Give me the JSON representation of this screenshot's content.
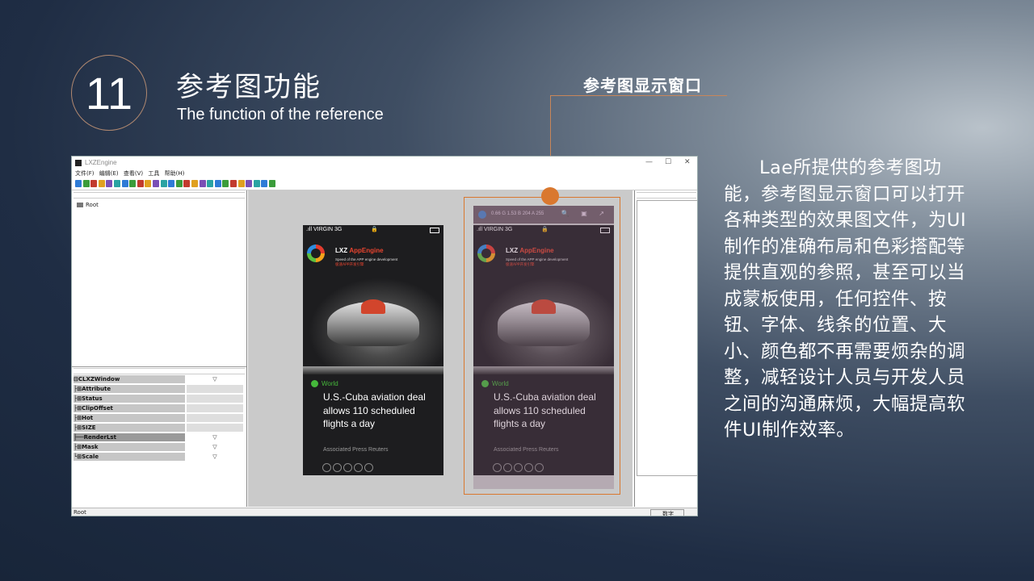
{
  "slide": {
    "number": "11",
    "title_cn": "参考图功能",
    "title_en": "The function of the reference",
    "callout_label": "参考图显示窗口",
    "description": "Lae所提供的参考图功能，参考图显示窗口可以打开各种类型的效果图文件，为UI制作的准确布局和色彩搭配等提供直观的参照，甚至可以当成蒙板使用，任何控件、按钮、字体、线条的位置、大小、颜色都不再需要烦杂的调整，减轻设计人员与开发人员之间的沟通麻烦，大幅提高软件UI制作效率。"
  },
  "app": {
    "window_title": "LXZEngine",
    "window_controls": [
      "—",
      "☐",
      "✕"
    ],
    "menu": [
      "文件(F)",
      "编辑(E)",
      "查看(V)",
      "工具",
      "帮助(H)"
    ],
    "tree_root": "Root",
    "properties": [
      {
        "name": "⊟CLXZWindow",
        "value": "▽",
        "dark": false
      },
      {
        "name": "├⊞Attribute",
        "value": "",
        "dark": false
      },
      {
        "name": "├⊞Status",
        "value": "",
        "dark": false
      },
      {
        "name": "├⊞ClipOffset",
        "value": "",
        "dark": false
      },
      {
        "name": "├⊞Hot",
        "value": "",
        "dark": false
      },
      {
        "name": "├⊞SIZE",
        "value": "",
        "dark": false
      },
      {
        "name": "├──RenderLst",
        "value": "▽",
        "dark": true
      },
      {
        "name": "├⊞Mask",
        "value": "▽",
        "dark": false
      },
      {
        "name": "└⊞Scale",
        "value": "▽",
        "dark": false
      }
    ],
    "status_left": "Root",
    "status_right": "数字",
    "colors": {
      "accent": "#d9782f",
      "toolbar_icons": [
        "#2e7bd6",
        "#3b9c3b",
        "#c23b2e",
        "#e0a020",
        "#7a4fb5",
        "#2aa3a3"
      ]
    }
  },
  "phone": {
    "status_carrier": "VIRGIN",
    "status_network": "3G",
    "brand_prefix": "LXZ",
    "brand_name": "AppEngine",
    "tagline": "Speed of the APP engine development",
    "tagline_cn": "极速APP开发引擎",
    "category": "World",
    "headline": "U.S.-Cuba aviation deal allows 110 scheduled flights a day",
    "source": "Associated Press Reuters",
    "ref_info": "0.66 G 1.53 B 204 A 255",
    "ref_icons": "🔍 ▣ ↗"
  }
}
